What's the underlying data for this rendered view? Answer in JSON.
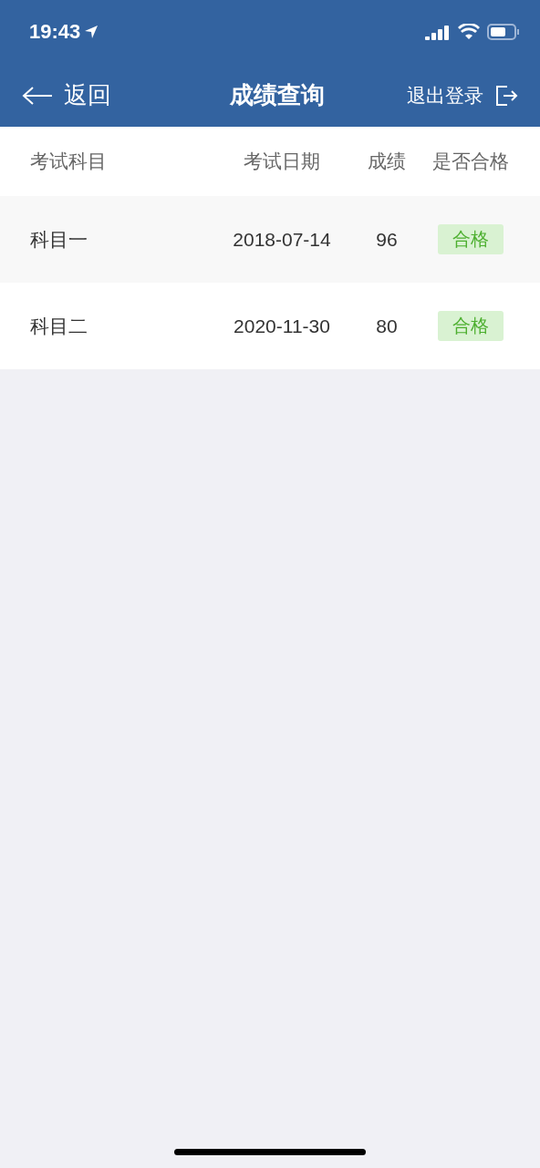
{
  "status_bar": {
    "time": "19:43"
  },
  "nav": {
    "back": "返回",
    "title": "成绩查询",
    "logout": "退出登录"
  },
  "table": {
    "columns": [
      "考试科目",
      "考试日期",
      "成绩",
      "是否合格"
    ],
    "rows": [
      {
        "subject": "科目一",
        "date": "2018-07-14",
        "score": "96",
        "result": "合格",
        "passed": true
      },
      {
        "subject": "科目二",
        "date": "2020-11-30",
        "score": "80",
        "result": "合格",
        "passed": true
      }
    ]
  }
}
